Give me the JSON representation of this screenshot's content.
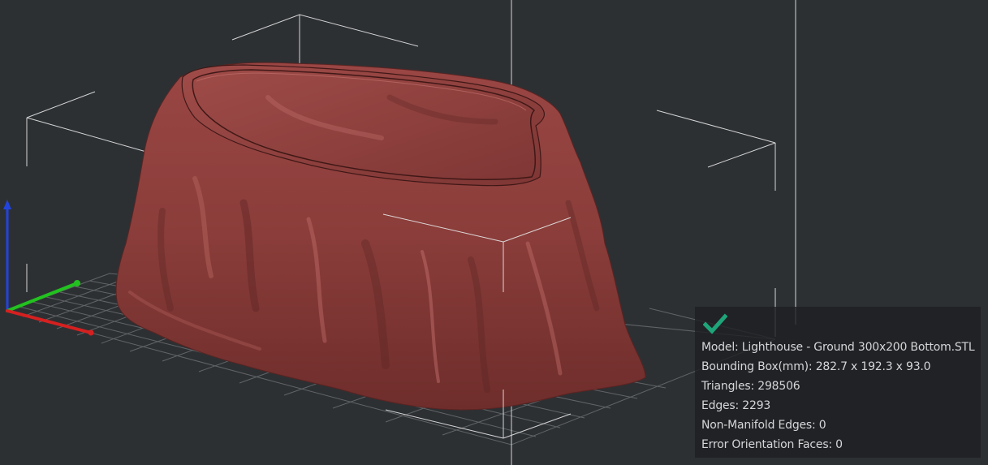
{
  "colors": {
    "background": "#2d3033",
    "model": "#8a3d3a",
    "model_shadow": "#5a2422",
    "model_highlight": "#c77470",
    "bounding_box": "#e6e6e6",
    "grid": "#8c8f93",
    "axis_x": "#d62020",
    "axis_y": "#22c21f",
    "axis_z": "#2244dd",
    "check": "#1ea57a",
    "panel_text": "#d4d6d8"
  },
  "icons": {
    "status": "checkmark-icon"
  },
  "model_info": {
    "model": "Model: Lighthouse - Ground 300x200 Bottom.STL",
    "bounding_box": "Bounding Box(mm): 282.7 x 192.3 x 93.0",
    "triangles": "Triangles: 298506",
    "edges": "Edges: 2293",
    "non_manifold_edges": "Non-Manifold Edges: 0",
    "error_orientation_faces": "Error Orientation Faces: 0"
  }
}
